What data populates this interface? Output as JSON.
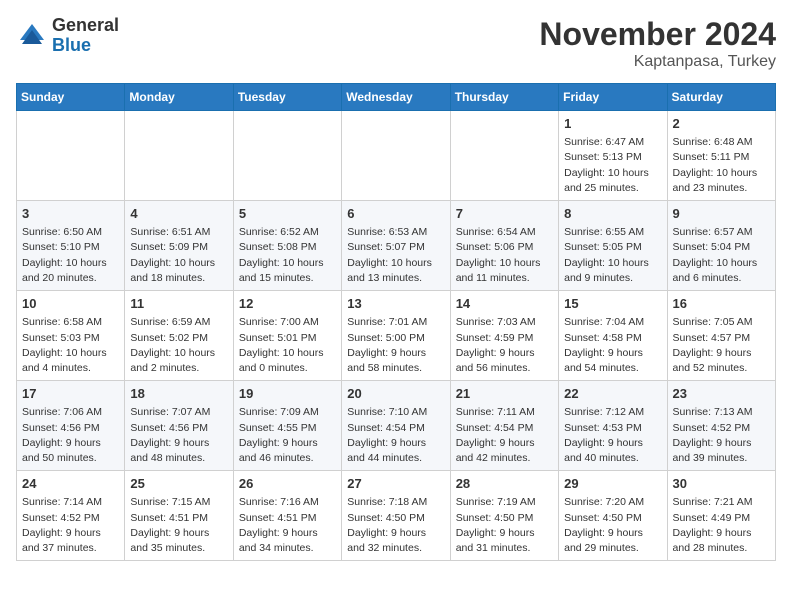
{
  "header": {
    "logo_general": "General",
    "logo_blue": "Blue",
    "month_title": "November 2024",
    "location": "Kaptanpasa, Turkey"
  },
  "days_of_week": [
    "Sunday",
    "Monday",
    "Tuesday",
    "Wednesday",
    "Thursday",
    "Friday",
    "Saturday"
  ],
  "weeks": [
    [
      {
        "day": "",
        "info": ""
      },
      {
        "day": "",
        "info": ""
      },
      {
        "day": "",
        "info": ""
      },
      {
        "day": "",
        "info": ""
      },
      {
        "day": "",
        "info": ""
      },
      {
        "day": "1",
        "info": "Sunrise: 6:47 AM\nSunset: 5:13 PM\nDaylight: 10 hours and 25 minutes."
      },
      {
        "day": "2",
        "info": "Sunrise: 6:48 AM\nSunset: 5:11 PM\nDaylight: 10 hours and 23 minutes."
      }
    ],
    [
      {
        "day": "3",
        "info": "Sunrise: 6:50 AM\nSunset: 5:10 PM\nDaylight: 10 hours and 20 minutes."
      },
      {
        "day": "4",
        "info": "Sunrise: 6:51 AM\nSunset: 5:09 PM\nDaylight: 10 hours and 18 minutes."
      },
      {
        "day": "5",
        "info": "Sunrise: 6:52 AM\nSunset: 5:08 PM\nDaylight: 10 hours and 15 minutes."
      },
      {
        "day": "6",
        "info": "Sunrise: 6:53 AM\nSunset: 5:07 PM\nDaylight: 10 hours and 13 minutes."
      },
      {
        "day": "7",
        "info": "Sunrise: 6:54 AM\nSunset: 5:06 PM\nDaylight: 10 hours and 11 minutes."
      },
      {
        "day": "8",
        "info": "Sunrise: 6:55 AM\nSunset: 5:05 PM\nDaylight: 10 hours and 9 minutes."
      },
      {
        "day": "9",
        "info": "Sunrise: 6:57 AM\nSunset: 5:04 PM\nDaylight: 10 hours and 6 minutes."
      }
    ],
    [
      {
        "day": "10",
        "info": "Sunrise: 6:58 AM\nSunset: 5:03 PM\nDaylight: 10 hours and 4 minutes."
      },
      {
        "day": "11",
        "info": "Sunrise: 6:59 AM\nSunset: 5:02 PM\nDaylight: 10 hours and 2 minutes."
      },
      {
        "day": "12",
        "info": "Sunrise: 7:00 AM\nSunset: 5:01 PM\nDaylight: 10 hours and 0 minutes."
      },
      {
        "day": "13",
        "info": "Sunrise: 7:01 AM\nSunset: 5:00 PM\nDaylight: 9 hours and 58 minutes."
      },
      {
        "day": "14",
        "info": "Sunrise: 7:03 AM\nSunset: 4:59 PM\nDaylight: 9 hours and 56 minutes."
      },
      {
        "day": "15",
        "info": "Sunrise: 7:04 AM\nSunset: 4:58 PM\nDaylight: 9 hours and 54 minutes."
      },
      {
        "day": "16",
        "info": "Sunrise: 7:05 AM\nSunset: 4:57 PM\nDaylight: 9 hours and 52 minutes."
      }
    ],
    [
      {
        "day": "17",
        "info": "Sunrise: 7:06 AM\nSunset: 4:56 PM\nDaylight: 9 hours and 50 minutes."
      },
      {
        "day": "18",
        "info": "Sunrise: 7:07 AM\nSunset: 4:56 PM\nDaylight: 9 hours and 48 minutes."
      },
      {
        "day": "19",
        "info": "Sunrise: 7:09 AM\nSunset: 4:55 PM\nDaylight: 9 hours and 46 minutes."
      },
      {
        "day": "20",
        "info": "Sunrise: 7:10 AM\nSunset: 4:54 PM\nDaylight: 9 hours and 44 minutes."
      },
      {
        "day": "21",
        "info": "Sunrise: 7:11 AM\nSunset: 4:54 PM\nDaylight: 9 hours and 42 minutes."
      },
      {
        "day": "22",
        "info": "Sunrise: 7:12 AM\nSunset: 4:53 PM\nDaylight: 9 hours and 40 minutes."
      },
      {
        "day": "23",
        "info": "Sunrise: 7:13 AM\nSunset: 4:52 PM\nDaylight: 9 hours and 39 minutes."
      }
    ],
    [
      {
        "day": "24",
        "info": "Sunrise: 7:14 AM\nSunset: 4:52 PM\nDaylight: 9 hours and 37 minutes."
      },
      {
        "day": "25",
        "info": "Sunrise: 7:15 AM\nSunset: 4:51 PM\nDaylight: 9 hours and 35 minutes."
      },
      {
        "day": "26",
        "info": "Sunrise: 7:16 AM\nSunset: 4:51 PM\nDaylight: 9 hours and 34 minutes."
      },
      {
        "day": "27",
        "info": "Sunrise: 7:18 AM\nSunset: 4:50 PM\nDaylight: 9 hours and 32 minutes."
      },
      {
        "day": "28",
        "info": "Sunrise: 7:19 AM\nSunset: 4:50 PM\nDaylight: 9 hours and 31 minutes."
      },
      {
        "day": "29",
        "info": "Sunrise: 7:20 AM\nSunset: 4:50 PM\nDaylight: 9 hours and 29 minutes."
      },
      {
        "day": "30",
        "info": "Sunrise: 7:21 AM\nSunset: 4:49 PM\nDaylight: 9 hours and 28 minutes."
      }
    ]
  ]
}
